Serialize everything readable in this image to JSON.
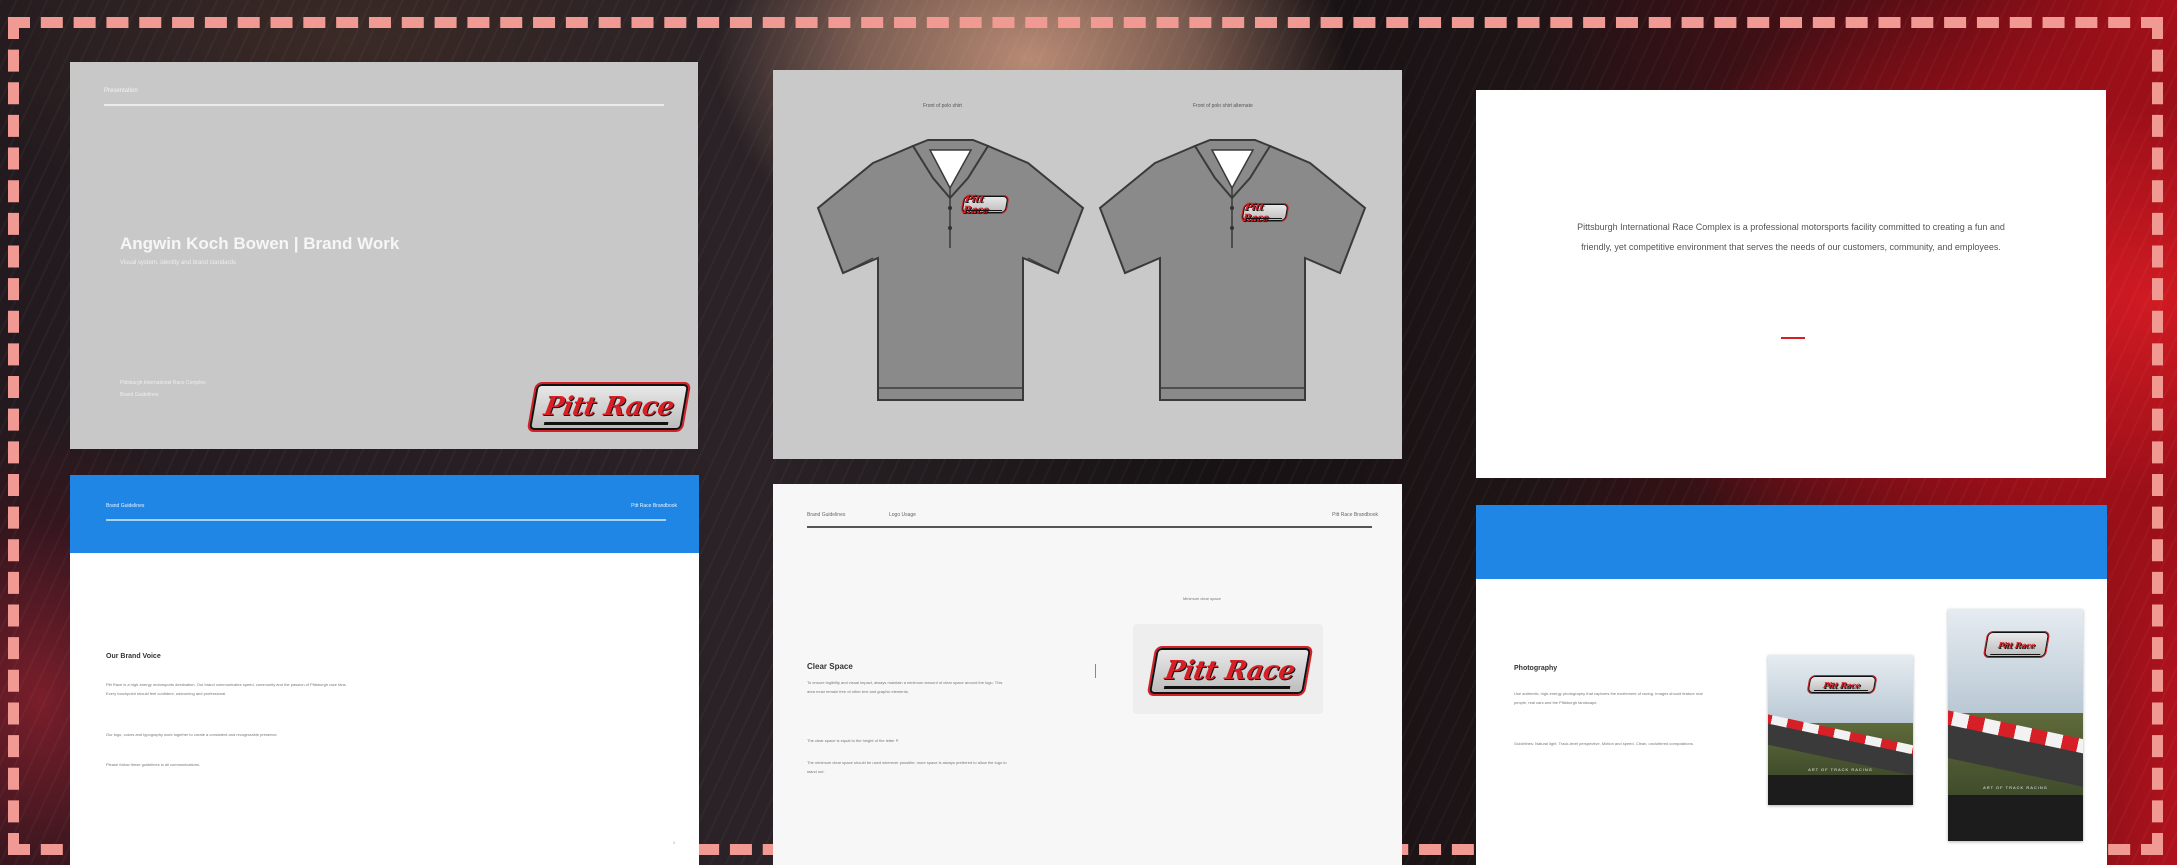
{
  "brand": {
    "logo_text": "Pitt Race",
    "colors": {
      "red": "#d61f26",
      "blue": "#1f86e6",
      "gray": "#c8c8c8",
      "border": "#f19a93"
    }
  },
  "cover_slide": {
    "label": "Presentation",
    "title": "Angwin Koch Bowen | Brand Work",
    "subtitle": "Visual system, identity and brand standards",
    "footer_line1": "Pittsburgh International Race Complex",
    "footer_line2": "Brand Guidelines"
  },
  "polo_slide": {
    "caption_left": "Front of polo shirt",
    "caption_right": "Front of polo shirt alternate"
  },
  "mission_slide": {
    "text": "Pittsburgh International Race Complex is a professional motorsports facility committed to creating a fun and friendly, yet competitive environment that serves the needs of our customers, community, and employees."
  },
  "brand_note_slide": {
    "header_left": "Brand Guidelines",
    "header_right": "Pitt Race Brandbook",
    "heading": "Our Brand Voice",
    "paragraphs": [
      "Pitt Race is a high-energy motorsports destination. Our brand communicates speed, community and the passion of Pittsburgh race fans. Every touchpoint should feel confident, welcoming and professional.",
      "Our logo, colors and typography work together to create a consistent and recognizable presence.",
      "Please follow these guidelines in all communications."
    ],
    "page_number": "3"
  },
  "clear_space_slide": {
    "header_a": "Brand Guidelines",
    "header_b": "Logo Usage",
    "header_right": "Pitt Race Brandbook",
    "heading": "Clear Space",
    "paragraphs": [
      "To ensure legibility and visual impact, always maintain a minimum amount of clear space around the logo. This area must remain free of other text and graphic elements.",
      "The clear space is equal to the height of the letter P.",
      "The minimum clear space should be used wherever possible; more space is always preferred to allow the logo to stand out."
    ],
    "logo_label": "Minimum clear space"
  },
  "photography_slide": {
    "heading": "Photography",
    "paragraphs": [
      "Use authentic, high-energy photography that captures the excitement of racing. Images should feature real people, real cars and the Pittsburgh landscape.",
      "Guidelines: Natural light. Track-level perspective. Motion and speed. Clean, uncluttered compositions."
    ],
    "poster_title": "ART OF TRACK RACING"
  }
}
